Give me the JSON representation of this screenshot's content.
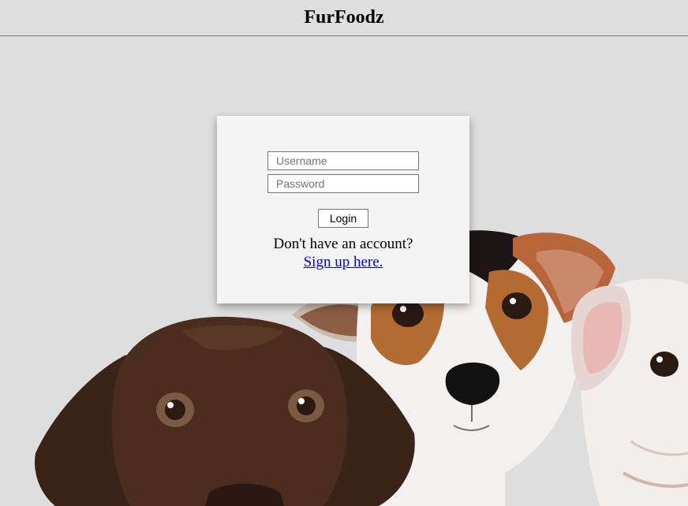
{
  "header": {
    "title": "FurFoodz"
  },
  "login_form": {
    "username_placeholder": "Username",
    "password_placeholder": "Password",
    "username_value": "",
    "password_value": "",
    "login_label": "Login",
    "prompt": "Don't have an account?",
    "signup_link": "Sign up here."
  },
  "background": {
    "icons": [
      "brown-puppy-illustration",
      "jack-russell-puppy-illustration",
      "bulldog-puppy-illustration"
    ]
  },
  "colors": {
    "page_background": "#dedede",
    "card_background": "#f4f4f4",
    "link": "#0000ee"
  }
}
